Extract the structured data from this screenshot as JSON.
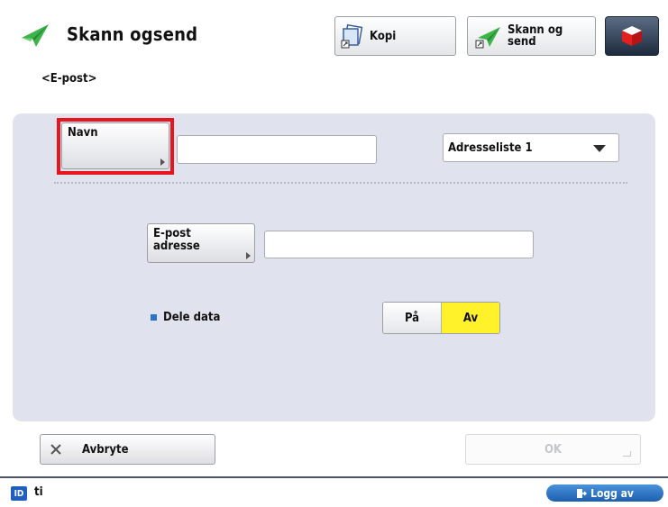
{
  "header": {
    "title": "Skann ogsend",
    "kopi_label": "Kopi",
    "skann_line1": "Skann og",
    "skann_line2": "send"
  },
  "breadcrumb": "<E-post>",
  "form": {
    "navn_label": "Navn",
    "navn_value": "",
    "address_list_selected": "Adresseliste 1",
    "epost_line1": "E-post",
    "epost_line2": "adresse",
    "epost_value": "",
    "share_label": "Dele data",
    "share_on": "På",
    "share_off": "Av",
    "share_selected": "Av"
  },
  "footer": {
    "cancel_label": "Avbryte",
    "ok_label": "OK"
  },
  "status": {
    "id_badge": "ID",
    "user": "ti",
    "logout_label": "Logg av"
  },
  "colors": {
    "panel_bg": "#e0e3ee",
    "highlight": "#e8141e",
    "selected_toggle": "#fff22a",
    "accent_blue": "#1f5fbf",
    "send_green": "#2fa43a"
  },
  "icons": {
    "app": "send-plane-icon",
    "kopi": "copy-icon",
    "skann": "send-plane-icon",
    "status": "status-monitor-icon",
    "cancel": "close-icon",
    "logout": "logout-icon"
  }
}
